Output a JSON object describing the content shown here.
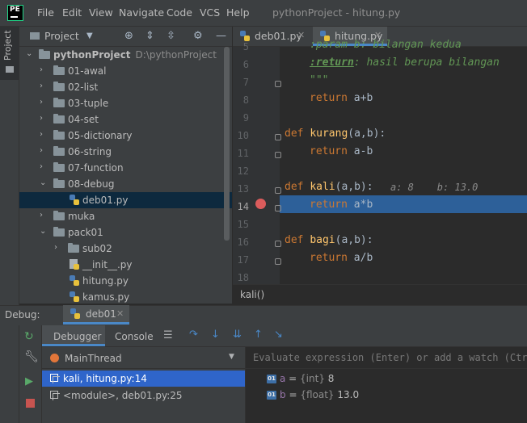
{
  "app": {
    "logo_text": "PE",
    "window_title": "pythonProject - hitung.py",
    "menu": [
      "File",
      "Edit",
      "View",
      "Navigate",
      "Code",
      "VCS",
      "Help"
    ]
  },
  "side_strip": {
    "project_tab": "Project"
  },
  "project_panel": {
    "title": "Project",
    "tree": [
      {
        "label": "pythonProject",
        "path": "D:\\pythonProject",
        "type": "folder",
        "expanded": true,
        "depth": 0
      },
      {
        "label": "01-awal",
        "type": "folder",
        "expanded": false,
        "depth": 1
      },
      {
        "label": "02-list",
        "type": "folder",
        "expanded": false,
        "depth": 1
      },
      {
        "label": "03-tuple",
        "type": "folder",
        "expanded": false,
        "depth": 1
      },
      {
        "label": "04-set",
        "type": "folder",
        "expanded": false,
        "depth": 1
      },
      {
        "label": "05-dictionary",
        "type": "folder",
        "expanded": false,
        "depth": 1
      },
      {
        "label": "06-string",
        "type": "folder",
        "expanded": false,
        "depth": 1
      },
      {
        "label": "07-function",
        "type": "folder",
        "expanded": false,
        "depth": 1
      },
      {
        "label": "08-debug",
        "type": "folder",
        "expanded": true,
        "depth": 1
      },
      {
        "label": "deb01.py",
        "type": "python",
        "selected": true,
        "depth": 2
      },
      {
        "label": "muka",
        "type": "folder",
        "expanded": false,
        "depth": 1
      },
      {
        "label": "pack01",
        "type": "folder",
        "expanded": true,
        "depth": 1
      },
      {
        "label": "sub02",
        "type": "folder",
        "expanded": false,
        "depth": 2
      },
      {
        "label": "__init__.py",
        "type": "python",
        "depth": 2
      },
      {
        "label": "hitung.py",
        "type": "python",
        "depth": 2
      },
      {
        "label": "kamus.py",
        "type": "python",
        "depth": 2
      }
    ]
  },
  "editor": {
    "tabs": [
      {
        "label": "deb01.py",
        "active": false
      },
      {
        "label": "hitung.py",
        "active": true
      }
    ],
    "line_numbers": [
      "5",
      "6",
      "7",
      "8",
      "9",
      "10",
      "11",
      "12",
      "13",
      "14",
      "15",
      "16",
      "17",
      "18"
    ],
    "current_line": "14",
    "breakpoint_line": "14",
    "code": {
      "l5": ":param b: bilangan kedua",
      "l6_tag": ":return",
      "l6_rest": ": hasil berupa bilangan",
      "l7": "\"\"\"",
      "l8_kw": "return",
      "l8_rest": " a+b",
      "l10_kw": "def",
      "l10_fn": "kurang",
      "l10_rest": "(a,b):",
      "l11_kw": "return",
      "l11_rest": " a-b",
      "l13_kw": "def",
      "l13_fn": "kali",
      "l13_rest": "(a,b):",
      "l13_inline": "a: 8    b: 13.0",
      "l14_kw": "return",
      "l14_rest": " a*b",
      "l16_kw": "def",
      "l16_fn": "bagi",
      "l16_rest": "(a,b):",
      "l17_kw": "return",
      "l17_rest": " a/b"
    },
    "breadcrumb": "kali()"
  },
  "debug": {
    "label": "Debug:",
    "run_config": "deb01",
    "tabs": [
      "Debugger",
      "Console"
    ],
    "thread": "MainThread",
    "frames": [
      {
        "label": "kali, hitung.py:14",
        "selected": true
      },
      {
        "label": "<module>, deb01.py:25",
        "selected": false
      }
    ],
    "evaluate_placeholder": "Evaluate expression (Enter) or add a watch (Ctrl+",
    "variables": [
      {
        "icon": "01",
        "name": "a",
        "type": "{int}",
        "value": "8"
      },
      {
        "icon": "01",
        "name": "b",
        "type": "{float}",
        "value": "13.0"
      }
    ]
  },
  "colors": {
    "accent": "#4a88c7",
    "selection": "#2f65ca",
    "highlight_line": "#2d6099",
    "breakpoint": "#db5c5c"
  }
}
